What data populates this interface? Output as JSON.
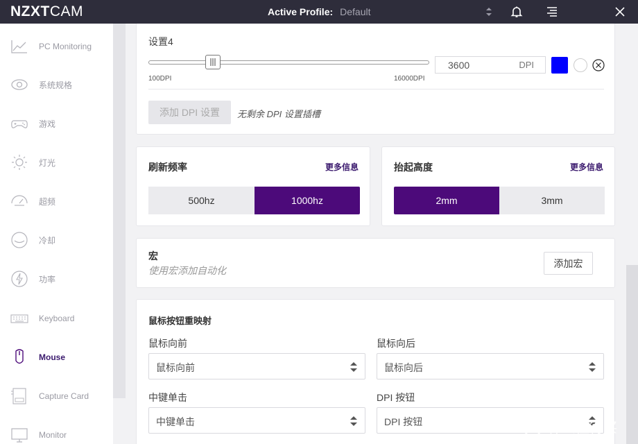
{
  "app": {
    "logo_bold": "NZXT",
    "logo_light": "CAM"
  },
  "header": {
    "profile_label": "Active Profile:",
    "profile_value": "Default"
  },
  "sidebar": {
    "items": [
      {
        "label": "PC Monitoring",
        "icon": "chart-line-icon"
      },
      {
        "label": "系统规格",
        "icon": "eye-icon"
      },
      {
        "label": "游戏",
        "icon": "gamepad-icon"
      },
      {
        "label": "灯光",
        "icon": "sun-icon"
      },
      {
        "label": "超频",
        "icon": "gauge-icon"
      },
      {
        "label": "冷却",
        "icon": "fan-icon"
      },
      {
        "label": "功率",
        "icon": "lightning-icon"
      },
      {
        "label": "Keyboard",
        "icon": "keyboard-icon"
      },
      {
        "label": "Mouse",
        "icon": "mouse-icon",
        "active": true
      },
      {
        "label": "Capture Card",
        "icon": "capture-card-icon"
      },
      {
        "label": "Monitor",
        "icon": "monitor-icon"
      }
    ]
  },
  "dpi": {
    "setting_label": "设置4",
    "min_label": "100DPI",
    "max_label": "16000DPI",
    "value": "3600",
    "unit": "DPI",
    "slider_value": 3600,
    "slider_min": 100,
    "slider_max": 16000,
    "color": "#0000ff",
    "add_button": "添加 DPI 设置",
    "no_slot_note": "无剩余 DPI 设置插槽"
  },
  "refresh": {
    "title": "刷新频率",
    "more": "更多信息",
    "options": [
      "500hz",
      "1000hz"
    ],
    "selected": "1000hz"
  },
  "lift": {
    "title": "抬起高度",
    "more": "更多信息",
    "options": [
      "2mm",
      "3mm"
    ],
    "selected": "2mm"
  },
  "macro": {
    "title": "宏",
    "subtitle": "使用宏添加自动化",
    "add_button": "添加宏"
  },
  "remap": {
    "title": "鼠标按钮重映射",
    "fields": [
      {
        "label": "鼠标向前",
        "value": "鼠标向前"
      },
      {
        "label": "鼠标向后",
        "value": "鼠标向后"
      },
      {
        "label": "中键单击",
        "value": "中键单击"
      },
      {
        "label": "DPI 按钮",
        "value": "DPI 按钮"
      }
    ]
  },
  "watermark": {
    "text": "什么值得买"
  },
  "colors": {
    "accent": "#4c0a7a",
    "topbar": "#2e2d3b",
    "link": "#3b1a6e"
  }
}
